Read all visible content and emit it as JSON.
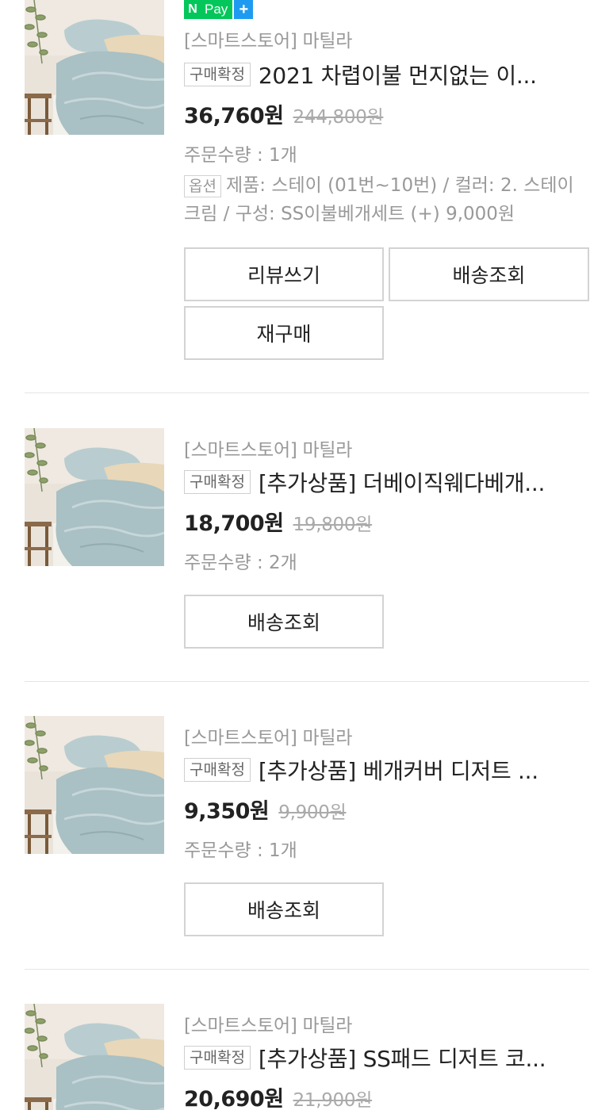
{
  "npay_badge": {
    "n": "N",
    "pay": "Pay",
    "plus": "+"
  },
  "orders": [
    {
      "store": "[스마트스토어] 마틸라",
      "status": "구매확정",
      "title": "2021 차렵이불 먼지없는 이...",
      "price": "36,760원",
      "original_price": "244,800원",
      "quantity": "주문수량 : 1개",
      "option_label": "옵션",
      "option_text": "제품: 스테이 (01번~10번) / 컬러: 2. 스테이 크림 / 구성: SS이불베개세트 (+) 9,000원",
      "buttons": [
        "리뷰쓰기",
        "배송조회",
        "재구매"
      ]
    },
    {
      "store": "[스마트스토어] 마틸라",
      "status": "구매확정",
      "title": "[추가상품] 더베이직웨다베개...",
      "price": "18,700원",
      "original_price": "19,800원",
      "quantity": "주문수량 : 2개",
      "buttons": [
        "배송조회"
      ]
    },
    {
      "store": "[스마트스토어] 마틸라",
      "status": "구매확정",
      "title": "[추가상품] 베개커버 디저트 ...",
      "price": "9,350원",
      "original_price": "9,900원",
      "quantity": "주문수량 : 1개",
      "buttons": [
        "배송조회"
      ]
    },
    {
      "store": "[스마트스토어] 마틸라",
      "status": "구매확정",
      "title": "[추가상품] SS패드 디저트 코...",
      "price": "20,690원",
      "original_price": "21,900원"
    }
  ]
}
